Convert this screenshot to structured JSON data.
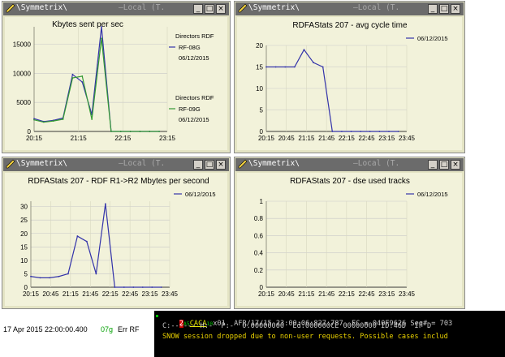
{
  "windows": [
    {
      "title": "\\Symmetrix\\",
      "title_faded": "—Local (T.",
      "chart_index": 0
    },
    {
      "title": "\\Symmetrix\\",
      "title_faded": "—Local (T.",
      "chart_index": 1
    },
    {
      "title": "\\Symmetrix\\",
      "title_faded": "—Local (T.",
      "chart_index": 2
    },
    {
      "title": "\\Symmetrix\\",
      "title_faded": "—Local (T.",
      "chart_index": 3
    }
  ],
  "window_buttons": {
    "minimize": "_",
    "maximize": "□",
    "close": "×"
  },
  "colors": {
    "panel_bg": "#e4e4c4",
    "plot_bg": "#f2f2da",
    "titlebar": "#6b6b6b",
    "series_blue": "#3333aa",
    "series_green": "#339933",
    "terminal_bg": "#000000",
    "terminal_text": "#c8c8c8",
    "terminal_yellow": "#e8d000",
    "terminal_red": "#ff2020",
    "status_green": "#00a000"
  },
  "chart_data": [
    {
      "type": "line",
      "title": "Kbytes sent per sec",
      "categories": [
        "20:15",
        "21:15",
        "22:15",
        "23:15"
      ],
      "ylim": [
        0,
        18000
      ],
      "yticks": [
        0,
        5000,
        10000,
        15000
      ],
      "x": [
        0,
        1,
        2,
        3,
        4,
        5,
        6,
        7,
        8,
        9,
        10,
        11,
        12,
        13
      ],
      "series": [
        {
          "name": "RF-08G",
          "legend_header": "Directors RDF",
          "legend_date": "06/12/2015",
          "color": "#3333aa",
          "values": [
            2200,
            1700,
            1900,
            2300,
            9800,
            8500,
            2900,
            18000,
            0,
            0,
            0,
            0,
            0,
            0
          ]
        },
        {
          "name": "RF-09G",
          "legend_header": "Directors RDF",
          "legend_date": "06/12/2015",
          "color": "#339933",
          "values": [
            2000,
            1600,
            1800,
            2100,
            9200,
            9500,
            2100,
            16000,
            0,
            0,
            0,
            0,
            0,
            0
          ]
        }
      ]
    },
    {
      "type": "line",
      "title": "RDFAStats 207 - avg cycle time",
      "categories": [
        "20:15",
        "20:45",
        "21:15",
        "21:45",
        "22:15",
        "22:45",
        "23:15",
        "23:45"
      ],
      "ylim": [
        0,
        20
      ],
      "yticks": [
        0,
        5,
        10,
        15,
        20
      ],
      "series": [
        {
          "name": "06/12/2015",
          "color": "#3333aa",
          "values": [
            15,
            15,
            15,
            15,
            19,
            16,
            15,
            0,
            0,
            0,
            0,
            0,
            0,
            0,
            0
          ]
        }
      ]
    },
    {
      "type": "line",
      "title": "RDFAStats 207 - RDF R1->R2 Mbytes per second",
      "categories": [
        "20:15",
        "20:45",
        "21:15",
        "21:45",
        "22:15",
        "22:45",
        "23:15",
        "23:45"
      ],
      "ylim": [
        0,
        32
      ],
      "yticks": [
        0,
        5,
        10,
        15,
        20,
        25,
        30
      ],
      "series": [
        {
          "name": "06/12/2015",
          "color": "#3333aa",
          "values": [
            4,
            3.5,
            3.5,
            4,
            5,
            19,
            17,
            5,
            31,
            0,
            0,
            0,
            0,
            0,
            0
          ]
        }
      ]
    },
    {
      "type": "line",
      "title": "RDFAStats 207 - dse used tracks",
      "categories": [
        "20:15",
        "20:45",
        "21:15",
        "21:45",
        "22:15",
        "22:45",
        "23:15",
        "23:45"
      ],
      "ylim": [
        0,
        1
      ],
      "yticks": [
        0,
        0.2,
        0.4,
        0.6,
        0.8,
        1
      ],
      "series": [
        {
          "name": "06/12/2015",
          "color": "#3333aa",
          "values": []
        }
      ]
    }
  ],
  "status_strip": {
    "timestamp": "17 Apr 2015 22:00:00.400",
    "code": "07g",
    "label": "Err RF"
  },
  "terminal": {
    "line1_prefix": "2",
    "line1_small": "A5",
    "line1_highlight": "CACA",
    "line1_small2": "10",
    "line1_rest": "x01  AFR/17/15 23:00:06:827:787  FC = 040F9626 Seq# = 703",
    "line2": "C:------ H:-  P:-  0.00000000  Ed:000000CE 00000000 ID:46D  IF D",
    "line3": "SNOW session dropped due to non-user requests. Possible cases includ"
  }
}
